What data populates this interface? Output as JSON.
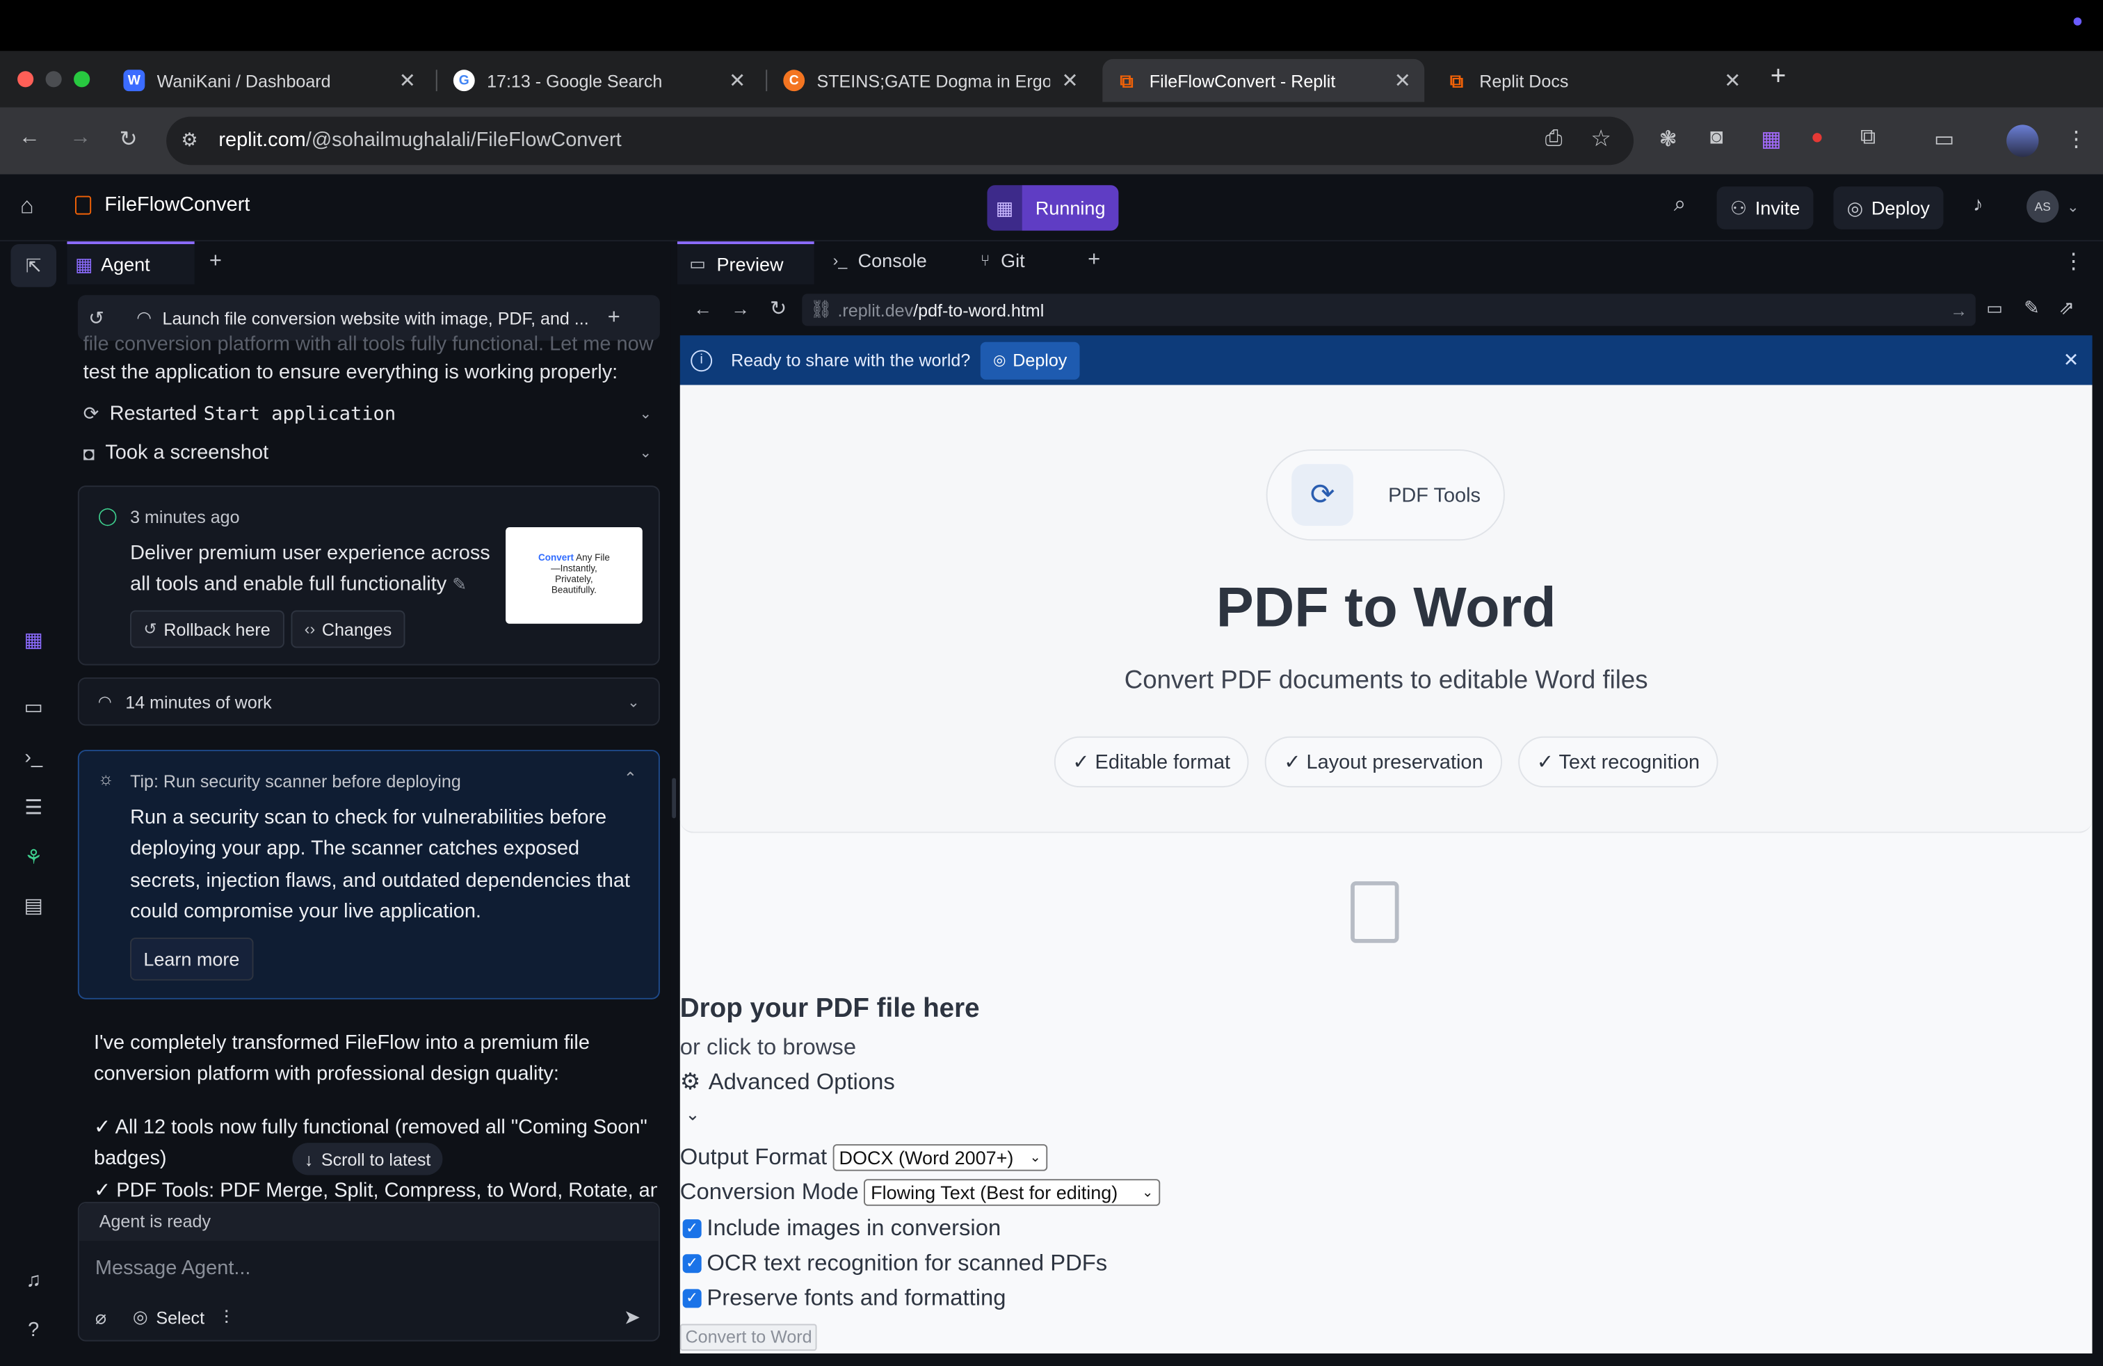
{
  "browser": {
    "tabs": [
      {
        "title": "WaniKani / Dashboard"
      },
      {
        "title": "17:13 - Google Search"
      },
      {
        "title": "STEINS;GATE Dogma in Ergosphere"
      },
      {
        "title": "FileFlowConvert - Replit"
      },
      {
        "title": "Replit Docs"
      }
    ],
    "new_tab_label": "+",
    "url_domain": "replit.com",
    "url_path": "/@sohailmughalali/FileFlowConvert"
  },
  "header": {
    "project_name": "FileFlowConvert",
    "run_status": "Running",
    "invite_label": "Invite",
    "deploy_label": "Deploy",
    "avatar_initials": "AS"
  },
  "agent": {
    "tab_label": "Agent",
    "task_title": "Launch file conversion website with image, PDF, and ...",
    "faded_text": "file conversion platform with all tools fully functional. Let me now",
    "intro_text": "test the application to ensure everything is working properly:",
    "actions": [
      {
        "prefix": "Restarted",
        "code": "Start application"
      },
      {
        "prefix": "Took a screenshot",
        "code": ""
      }
    ],
    "checkpoint": {
      "time": "3 minutes ago",
      "message": "Deliver premium user experience across all tools and enable full functionality",
      "rollback_label": "Rollback here",
      "changes_label": "Changes",
      "thumb_title_a": "Convert",
      "thumb_title_b": "Any File",
      "thumb_title_c": "—Instantly,",
      "thumb_title_d": "Privately,",
      "thumb_title_e": "Beautifully."
    },
    "work_summary": "14 minutes of work",
    "tip": {
      "title": "Tip: Run security scanner before deploying",
      "body": "Run a security scan to check for vulnerabilities before deploying your app. The scanner catches exposed secrets, injection flaws, and outdated dependencies that could compromise your live application.",
      "learn_more": "Learn more"
    },
    "message_p1": "I've completely transformed FileFlow into a premium file conversion platform with professional design quality:",
    "bullet_1": "✓ All 12 tools now fully functional (removed all \"Coming Soon\" badges)",
    "bullet_2": "✓ PDF Tools: PDF Merge, Split, Compress, to Word, Rotate, and",
    "scroll_latest": "Scroll to latest",
    "status": "Agent is ready",
    "input_placeholder": "Message Agent...",
    "select_label": "Select"
  },
  "workspace": {
    "tabs": [
      {
        "label": "Preview"
      },
      {
        "label": "Console"
      },
      {
        "label": "Git"
      }
    ],
    "url_domain": ".replit.dev",
    "url_path": "/pdf-to-word.html",
    "banner_text": "Ready to share with the world?",
    "banner_button": "Deploy"
  },
  "preview": {
    "badge": "PDF Tools",
    "title": "PDF to Word",
    "subtitle": "Convert PDF documents to editable Word files",
    "features": [
      "✓ Editable format",
      "✓ Layout preservation",
      "✓ Text recognition"
    ],
    "drop_title": "Drop your PDF file here",
    "drop_sub": "or click to browse",
    "advanced": "Advanced Options",
    "output_format_label": "Output Format",
    "output_format_value": "DOCX (Word 2007+)",
    "conversion_mode_label": "Conversion Mode",
    "conversion_mode_value": "Flowing Text (Best for editing)",
    "options": [
      {
        "label": "Include images in conversion",
        "checked": true
      },
      {
        "label": "OCR text recognition for scanned PDFs",
        "checked": true
      },
      {
        "label": "Preserve fonts and formatting",
        "checked": true
      }
    ],
    "convert_button": "Convert to Word"
  },
  "colors": {
    "accent_purple": "#5f3dc4",
    "banner_blue": "#0d3b7a",
    "preview_bg": "#f8f9fb"
  }
}
